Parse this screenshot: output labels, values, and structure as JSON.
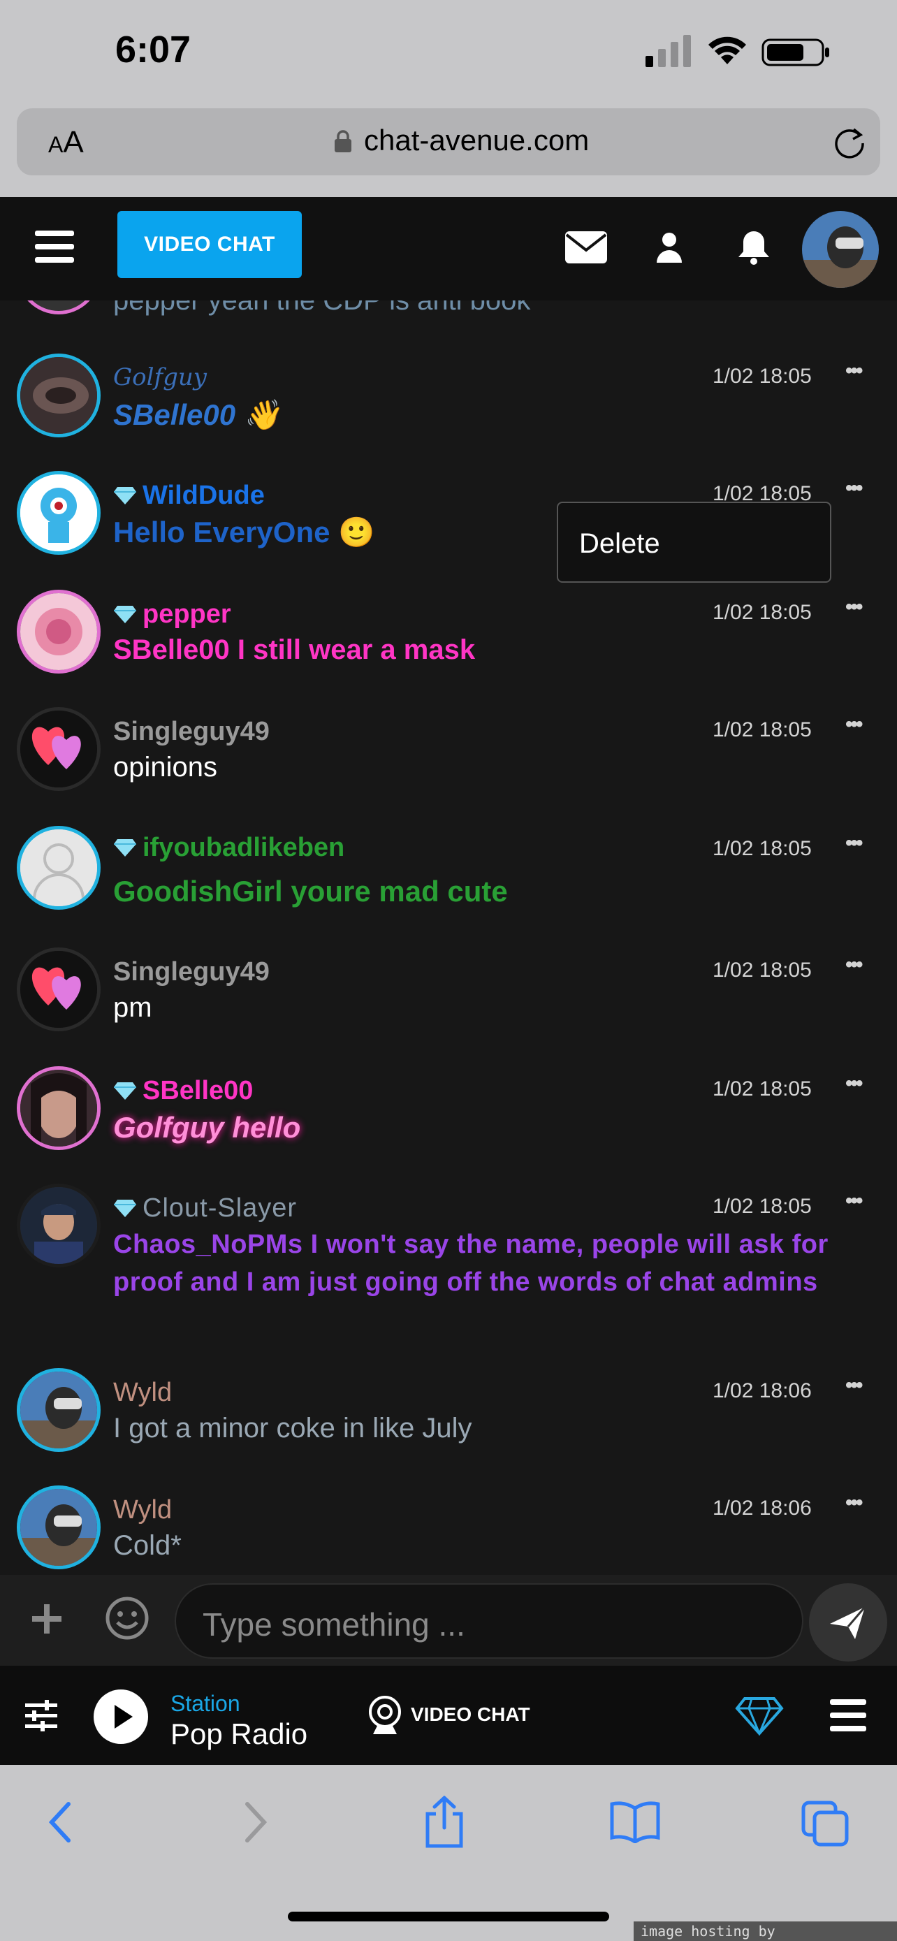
{
  "status_bar": {
    "time": "6:07"
  },
  "browser": {
    "url": "chat-avenue.com",
    "text_size_label": "AA"
  },
  "header": {
    "video_chat_label": "VIDEO CHAT"
  },
  "partial_message": "pepper yeah the CDP is anti book",
  "messages": [
    {
      "user": "Golfguy",
      "color": "#3b6fb8",
      "gem": false,
      "time": "1/02 18:05",
      "text": "SBelle00 👋",
      "text_color": "#2f74d0"
    },
    {
      "user": "WildDude",
      "color": "#1a73e8",
      "gem": true,
      "time": "1/02 18:05",
      "text": "Hello EveryOne 🙂",
      "text_color": "#1e63c9"
    },
    {
      "user": "pepper",
      "color": "#ff35c5",
      "gem": true,
      "time": "1/02 18:05",
      "text": "SBelle00 I still wear a mask",
      "text_color": "#ff35c5"
    },
    {
      "user": "Singleguy49",
      "color": "#9a9a9a",
      "gem": false,
      "time": "1/02 18:05",
      "text": "opinions",
      "text_color": "#ffffff"
    },
    {
      "user": "ifyoubadlikeben",
      "color": "#29a035",
      "gem": true,
      "time": "1/02 18:05",
      "text": "GoodishGirl youre mad cute",
      "text_color": "#29a035"
    },
    {
      "user": "Singleguy49",
      "color": "#9a9a9a",
      "gem": false,
      "time": "1/02 18:05",
      "text": "pm",
      "text_color": "#ffffff"
    },
    {
      "user": "SBelle00",
      "color": "#ff35c5",
      "gem": true,
      "time": "1/02 18:05",
      "text": "Golfguy hello",
      "text_color": "#ff8fd8"
    },
    {
      "user": "Clout-Slayer",
      "color": "#8a9aa8",
      "gem": true,
      "time": "1/02 18:05",
      "text": "Chaos_NoPMs I won't say the name, people will ask for proof and I am just going off the words of chat admins",
      "text_color": "#9a45e8"
    },
    {
      "user": "Wyld",
      "color": "#c09080",
      "gem": false,
      "time": "1/02 18:06",
      "text": "I got a minor coke in like July",
      "text_color": "#9aa8b4"
    },
    {
      "user": "Wyld",
      "color": "#c09080",
      "gem": false,
      "time": "1/02 18:06",
      "text": "Cold*",
      "text_color": "#9aa8b4"
    }
  ],
  "context_menu": {
    "delete_label": "Delete"
  },
  "composer": {
    "placeholder": "Type something ..."
  },
  "player": {
    "station_label": "Station",
    "station_name": "Pop Radio",
    "video_chat_label": "VIDEO CHAT"
  },
  "watermark": "image hosting by www.img.vision"
}
